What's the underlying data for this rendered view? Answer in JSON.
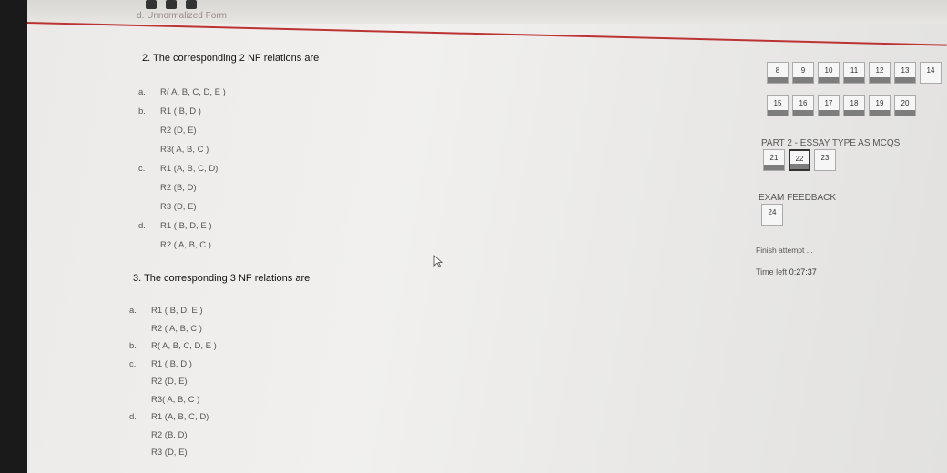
{
  "header": {
    "prev_text": "d.  Unnormalized Form"
  },
  "q2": {
    "title": "2. The corresponding 2 NF relations are",
    "options": [
      {
        "letter": "a.",
        "lines": [
          "R( A, B, C, D, E )"
        ]
      },
      {
        "letter": "b.",
        "lines": [
          "R1 ( B, D )",
          "R2 (D, E)",
          "R3( A, B, C )"
        ]
      },
      {
        "letter": "c.",
        "lines": [
          "R1 (A, B, C, D)",
          "R2 (B, D)",
          "R3 (D, E)"
        ]
      },
      {
        "letter": "d.",
        "lines": [
          "R1 ( B, D, E )",
          "R2 ( A, B, C )"
        ]
      }
    ]
  },
  "q3": {
    "title": "3. The corresponding 3 NF relations are",
    "options": [
      {
        "letter": "a.",
        "lines": [
          "R1 ( B, D, E )",
          "R2 ( A, B, C )"
        ]
      },
      {
        "letter": "b.",
        "lines": [
          "R( A, B, C, D, E )"
        ]
      },
      {
        "letter": "c.",
        "lines": [
          "R1 ( B, D )",
          "R2 (D, E)",
          "R3( A, B, C )"
        ]
      },
      {
        "letter": "d.",
        "lines": [
          "R1 (A, B, C, D)",
          "R2 (B, D)",
          "R3 (D, E)"
        ]
      }
    ]
  },
  "nav": {
    "row1": [
      "8",
      "9",
      "10",
      "11",
      "12",
      "13",
      "14"
    ],
    "row2": [
      "15",
      "16",
      "17",
      "18",
      "19",
      "20"
    ],
    "part2_label": "PART 2 - ESSAY TYPE AS MCQS",
    "row3": [
      "21",
      "22",
      "23"
    ],
    "feedback_label": "EXAM FEEDBACK",
    "row4": [
      "24"
    ],
    "finish": "Finish attempt ...",
    "time_left_label": "Time left",
    "time_left_value": "0:27:37"
  }
}
